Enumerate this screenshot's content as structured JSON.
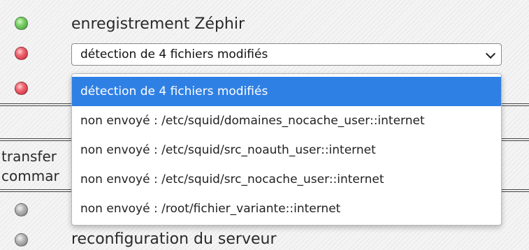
{
  "rows": {
    "zephir": {
      "label": "enregistrement Zéphir",
      "status": "green"
    },
    "transfer_partial": "transfer",
    "command_partial": "commar",
    "reconfig": {
      "label": "reconfiguration du serveur",
      "status": "gray"
    }
  },
  "select": {
    "value": "détection de 4 fichiers modifiés",
    "options": [
      "détection de 4 fichiers modifiés",
      "non envoyé : /etc/squid/domaines_nocache_user::internet",
      "non envoyé : /etc/squid/src_noauth_user::internet",
      "non envoyé : /etc/squid/src_nocache_user::internet",
      "non envoyé : /root/fichier_variante::internet"
    ],
    "selected_index": 0
  },
  "colors": {
    "selection": "#2f80e4",
    "led_green": "#5cc24a",
    "led_red": "#e03545",
    "led_gray": "#a0a0a0"
  }
}
